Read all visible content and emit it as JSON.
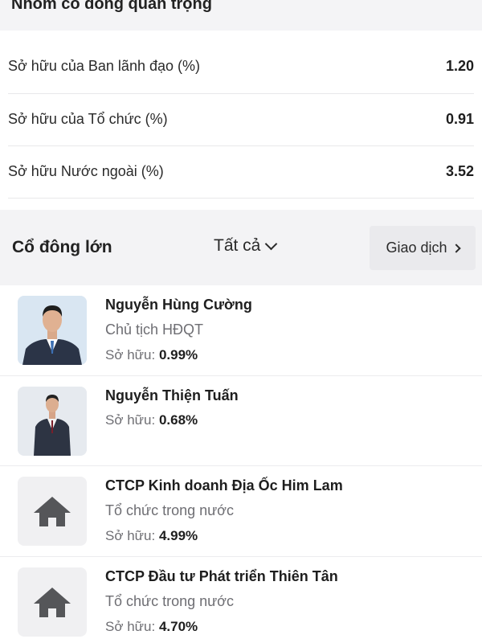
{
  "key_group": {
    "title": "Nhóm cổ đông quan trọng",
    "rows": [
      {
        "label": "Sở hữu của Ban lãnh đạo (%)",
        "value": "1.20"
      },
      {
        "label": "Sở hữu của Tổ chức (%)",
        "value": "0.91"
      },
      {
        "label": "Sở hữu Nước ngoài (%)",
        "value": "3.52"
      }
    ]
  },
  "major_holders": {
    "title": "Cổ đông lớn",
    "filter_label": "Tất cả",
    "trade_label": "Giao dịch",
    "own_prefix": "Sở hữu:",
    "items": [
      {
        "name": "Nguyễn Hùng Cường",
        "role": "Chủ tịch HĐQT",
        "share": "0.99%",
        "avatar": "person-photo-icon"
      },
      {
        "name": "Nguyễn Thiện Tuấn",
        "role": "",
        "share": "0.68%",
        "avatar": "person-photo-icon"
      },
      {
        "name": "CTCP Kinh doanh Địa Ốc Him Lam",
        "role": "Tổ chức trong nước",
        "share": "4.99%",
        "avatar": "house-icon"
      },
      {
        "name": "CTCP Đầu tư Phát triển Thiên Tân",
        "role": "Tổ chức trong nước",
        "share": "4.70%",
        "avatar": "house-icon"
      }
    ]
  }
}
